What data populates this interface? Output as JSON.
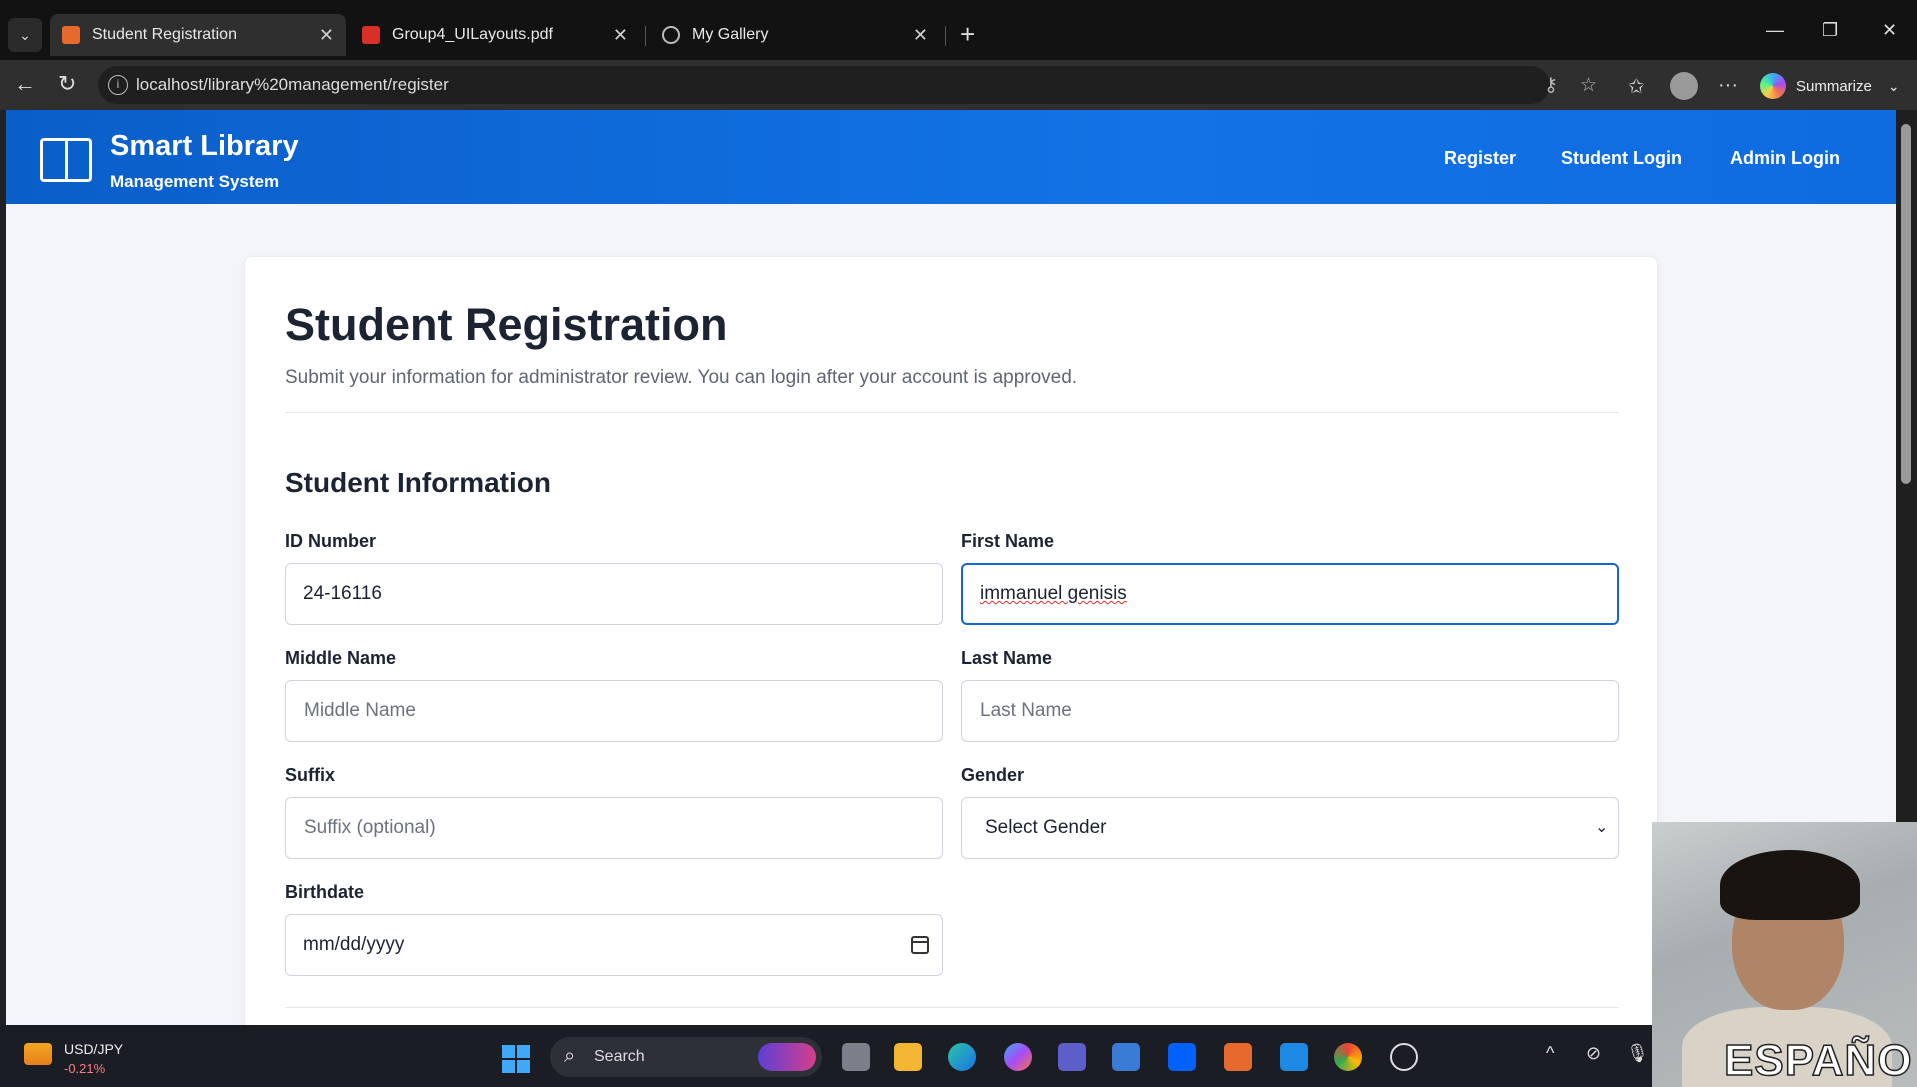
{
  "browser": {
    "tabs": [
      {
        "label": "Student Registration",
        "active": true,
        "favicon_color": "#e8692e"
      },
      {
        "label": "Group4_UILayouts.pdf",
        "active": false,
        "favicon_color": "#d93025"
      },
      {
        "label": "My Gallery",
        "active": false,
        "favicon_color": "#bbbbbb"
      }
    ],
    "url": "localhost/library%20management/register",
    "summarize_label": "Summarize"
  },
  "header": {
    "brand_title": "Smart Library",
    "brand_subtitle": "Management System",
    "nav": [
      "Register",
      "Student Login",
      "Admin Login"
    ],
    "accent": "#0f6be0"
  },
  "form": {
    "title": "Student Registration",
    "subtitle": "Submit your information for administrator review. You can login after your account is approved.",
    "section_title": "Student Information",
    "id_number": {
      "label": "ID Number",
      "value": "24-16116"
    },
    "first_name": {
      "label": "First Name",
      "value": "immanuel genisis"
    },
    "middle_name": {
      "label": "Middle Name",
      "placeholder": "Middle Name"
    },
    "last_name": {
      "label": "Last Name",
      "placeholder": "Last Name"
    },
    "suffix": {
      "label": "Suffix",
      "placeholder": "Suffix (optional)"
    },
    "gender": {
      "label": "Gender",
      "selected": "Select Gender"
    },
    "birthdate": {
      "label": "Birthdate",
      "placeholder": "mm/dd/yyyy"
    }
  },
  "taskbar": {
    "ticker_symbol": "USD/JPY",
    "ticker_change": "-0.21%",
    "search_label": "Search"
  },
  "webcam": {
    "caption": "ESPAÑO"
  }
}
